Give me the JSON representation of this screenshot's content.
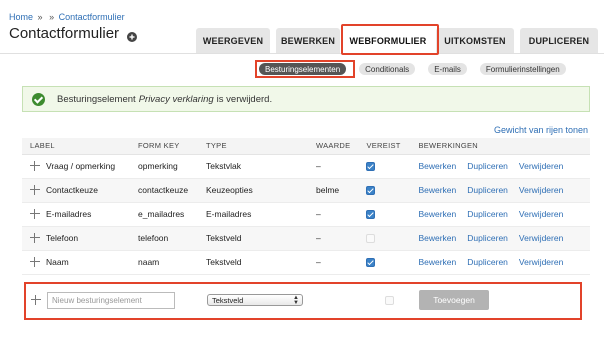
{
  "breadcrumb": {
    "home": "Home",
    "separator": "»",
    "current": "Contactformulier"
  },
  "page": {
    "title": "Contactformulier",
    "shortcut_icon": "plus-circle-icon"
  },
  "tabs": [
    {
      "label": "WEERGEVEN",
      "active": false
    },
    {
      "label": "BEWERKEN",
      "active": false
    },
    {
      "label": "WEBFORMULIER",
      "active": true
    },
    {
      "label": "UITKOMSTEN",
      "active": false
    },
    {
      "label": "DUPLICEREN",
      "active": false
    }
  ],
  "subtabs": [
    {
      "label": "Besturingselementen",
      "active": true
    },
    {
      "label": "Conditionals",
      "active": false
    },
    {
      "label": "E-mails",
      "active": false
    },
    {
      "label": "Formulierinstellingen",
      "active": false
    }
  ],
  "message": {
    "prefix": "Besturingselement",
    "name": "Privacy verklaring",
    "suffix": "is verwijderd.",
    "icon": "check-circle-icon"
  },
  "row_weight_link": "Gewicht van rijen tonen",
  "table": {
    "headers": {
      "label": "LABEL",
      "form_key": "FORM KEY",
      "type": "TYPE",
      "value": "WAARDE",
      "required": "VEREIST",
      "operations": "BEWERKINGEN"
    },
    "rows": [
      {
        "label": "Vraag / opmerking",
        "form_key": "opmerking",
        "type": "Tekstvlak",
        "value": "–",
        "required": true,
        "ops": [
          "Bewerken",
          "Dupliceren",
          "Verwijderen"
        ]
      },
      {
        "label": "Contactkeuze",
        "form_key": "contactkeuze",
        "type": "Keuzeopties",
        "value": "belme",
        "required": true,
        "ops": [
          "Bewerken",
          "Dupliceren",
          "Verwijderen"
        ]
      },
      {
        "label": "E-mailadres",
        "form_key": "e_mailadres",
        "type": "E-mailadres",
        "value": "–",
        "required": true,
        "ops": [
          "Bewerken",
          "Dupliceren",
          "Verwijderen"
        ]
      },
      {
        "label": "Telefoon",
        "form_key": "telefoon",
        "type": "Tekstveld",
        "value": "–",
        "required": false,
        "ops": [
          "Bewerken",
          "Dupliceren",
          "Verwijderen"
        ]
      },
      {
        "label": "Naam",
        "form_key": "naam",
        "type": "Tekstveld",
        "value": "–",
        "required": true,
        "ops": [
          "Bewerken",
          "Dupliceren",
          "Verwijderen"
        ]
      }
    ]
  },
  "add_row": {
    "placeholder": "Nieuw besturingselement",
    "type_selected": "Tekstveld",
    "required": false,
    "button_label": "Toevoegen"
  },
  "colors": {
    "link": "#2f6fb5",
    "highlight": "#e2432a",
    "success": "#3d8b2f",
    "checkbox": "#3b82c7"
  }
}
